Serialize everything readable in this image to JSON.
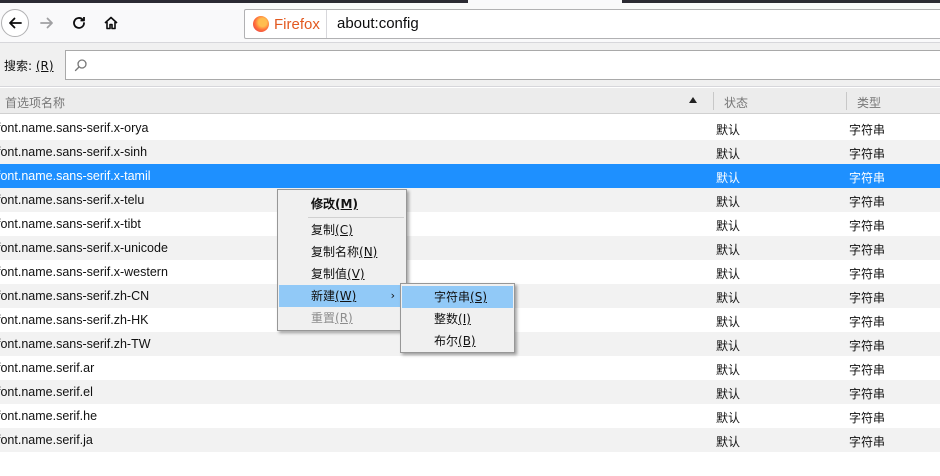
{
  "browser": {
    "brand": "Firefox",
    "url": "about:config",
    "icons": {
      "back": "back-arrow-icon",
      "forward": "forward-arrow-icon",
      "reload": "reload-icon",
      "home": "home-icon",
      "firefox": "firefox-logo-icon",
      "search": "search-icon"
    }
  },
  "search": {
    "label": "搜索: ",
    "label_key": "(R)",
    "value": ""
  },
  "columns": {
    "name": "首选项名称",
    "status": "状态",
    "type": "类型"
  },
  "rows": [
    {
      "name": "font.name.sans-serif.x-orya",
      "status": "默认",
      "type": "字符串"
    },
    {
      "name": "font.name.sans-serif.x-sinh",
      "status": "默认",
      "type": "字符串"
    },
    {
      "name": "font.name.sans-serif.x-tamil",
      "status": "默认",
      "type": "字符串"
    },
    {
      "name": "font.name.sans-serif.x-telu",
      "status": "默认",
      "type": "字符串"
    },
    {
      "name": "font.name.sans-serif.x-tibt",
      "status": "默认",
      "type": "字符串"
    },
    {
      "name": "font.name.sans-serif.x-unicode",
      "status": "默认",
      "type": "字符串"
    },
    {
      "name": "font.name.sans-serif.x-western",
      "status": "默认",
      "type": "字符串"
    },
    {
      "name": "font.name.sans-serif.zh-CN",
      "status": "默认",
      "type": "字符串"
    },
    {
      "name": "font.name.sans-serif.zh-HK",
      "status": "默认",
      "type": "字符串"
    },
    {
      "name": "font.name.sans-serif.zh-TW",
      "status": "默认",
      "type": "字符串"
    },
    {
      "name": "font.name.serif.ar",
      "status": "默认",
      "type": "字符串"
    },
    {
      "name": "font.name.serif.el",
      "status": "默认",
      "type": "字符串"
    },
    {
      "name": "font.name.serif.he",
      "status": "默认",
      "type": "字符串"
    },
    {
      "name": "font.name.serif.ja",
      "status": "默认",
      "type": "字符串"
    }
  ],
  "selected_row": "font.name.sans-serif.x-tamil",
  "context_menu": {
    "items": [
      {
        "label": "修改",
        "key": "(M)"
      },
      {
        "label": "复制",
        "key": "(C)"
      },
      {
        "label": "复制名称",
        "key": "(N)"
      },
      {
        "label": "复制值",
        "key": "(V)"
      },
      {
        "label": "新建",
        "key": "(W)"
      },
      {
        "label": "重置",
        "key": "(R)"
      }
    ],
    "submenu_arrow": "›"
  },
  "submenu": {
    "items": [
      {
        "label": "字符串",
        "key": "(S)"
      },
      {
        "label": "整数",
        "key": "(I)"
      },
      {
        "label": "布尔",
        "key": "(B)"
      }
    ]
  }
}
